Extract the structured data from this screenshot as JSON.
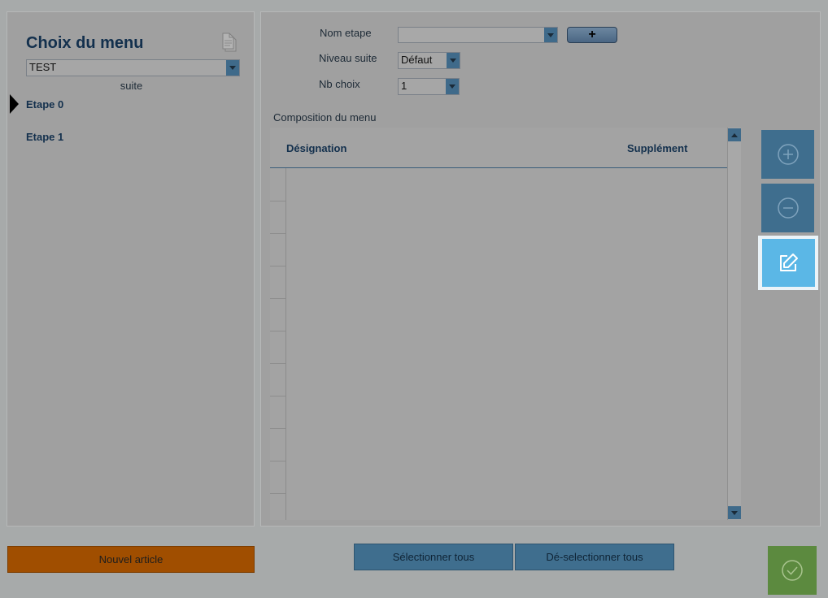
{
  "left_panel": {
    "title": "Choix du menu",
    "menu_select_value": "TEST",
    "suite_label": "suite",
    "steps": [
      {
        "label": "Etape 0",
        "selected": true
      },
      {
        "label": "Etape 1",
        "selected": false
      }
    ],
    "icons": {
      "document": "document-icon"
    }
  },
  "form": {
    "nom_etape_label": "Nom etape",
    "nom_etape_value": "",
    "add_step_label": "+",
    "niveau_suite_label": "Niveau suite",
    "niveau_suite_value": "Défaut",
    "nb_choix_label": "Nb choix",
    "nb_choix_value": "1"
  },
  "composition": {
    "section_label": "Composition du menu",
    "columns": [
      "Désignation",
      "Supplément"
    ],
    "rows": []
  },
  "side_actions": {
    "add_icon": "plus-circle-icon",
    "remove_icon": "minus-circle-icon",
    "edit_icon": "edit-icon"
  },
  "bottom": {
    "nouvel_article_label": "Nouvel article",
    "select_all_label": "Sélectionner tous",
    "deselect_all_label": "Dé-selectionner tous",
    "confirm_icon": "check-circle-icon"
  },
  "colors": {
    "accent_blue": "#3f6e8e",
    "highlight_blue": "#5bb7e6",
    "orange": "#a04e00",
    "green": "#5c8a3f"
  }
}
